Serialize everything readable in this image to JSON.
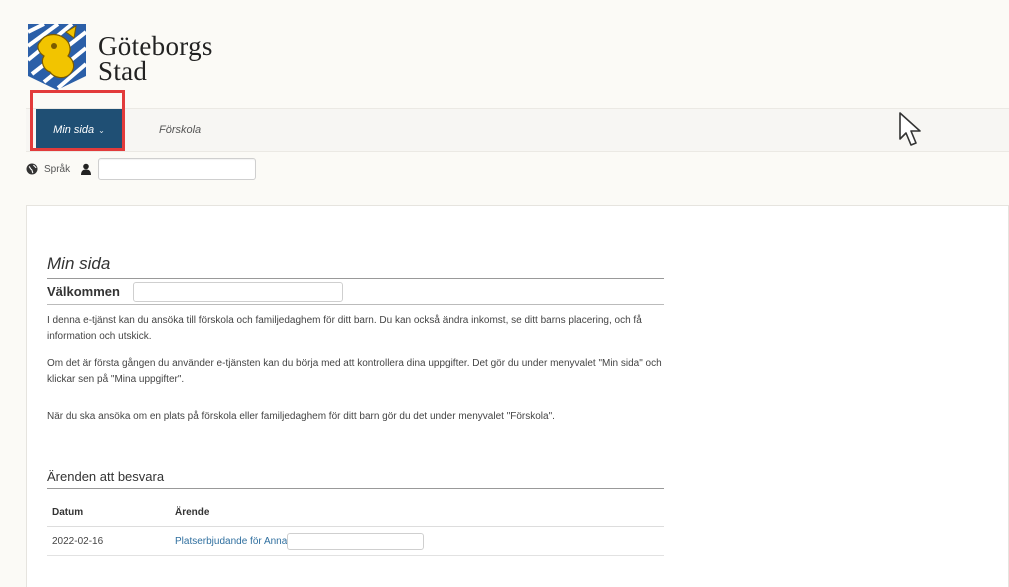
{
  "brand": {
    "line1": "Göteborgs",
    "line2": "Stad"
  },
  "nav": {
    "active_label": "Min sida",
    "active_caret": "⌄",
    "item_forskola": "Förskola"
  },
  "langbar": {
    "language_label": "Språk",
    "globe_icon": "globe-icon",
    "user_icon": "user-icon"
  },
  "main": {
    "title": "Min sida",
    "welcome_label": "Välkommen",
    "paragraphs": [
      "I denna e-tjänst kan du ansöka till förskola och familjedaghem för ditt barn. Du kan också ändra inkomst, se ditt barns placering, och få information och utskick.",
      "Om det är första gången du använder e-tjänsten kan du börja med att kontrollera dina uppgifter. Det gör du under menyvalet \"Min sida\" och klickar sen på \"Mina uppgifter\".",
      "När du ska ansöka om en plats på förskola eller familjedaghem för ditt barn gör du det under menyvalet \"Förskola\"."
    ],
    "cases_title": "Ärenden att besvara",
    "table": {
      "headers": [
        "Datum",
        "Ärende"
      ],
      "rows": [
        {
          "date": "2022-02-16",
          "case": "Platserbjudande för Anna"
        }
      ]
    }
  },
  "colors": {
    "nav_active_bg": "#1f4f74",
    "highlight": "#e23b3b",
    "link": "#2f6f9f"
  }
}
